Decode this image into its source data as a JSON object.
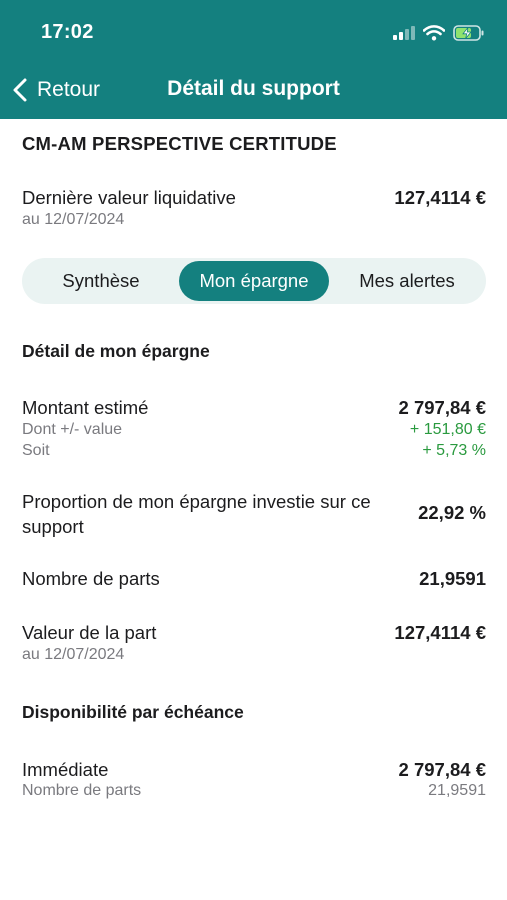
{
  "status_bar": {
    "time": "17:02"
  },
  "nav": {
    "back_label": "Retour",
    "title": "Détail du support"
  },
  "fund": {
    "name": "CM-AM PERSPECTIVE CERTITUDE",
    "nav_label": "Dernière valeur liquidative",
    "nav_date": "au 12/07/2024",
    "nav_value": "127,4114 €"
  },
  "tabs": [
    {
      "label": "Synthèse",
      "active": false
    },
    {
      "label": "Mon épargne",
      "active": true
    },
    {
      "label": "Mes alertes",
      "active": false
    }
  ],
  "savings_detail": {
    "section_title": "Détail de mon épargne",
    "estimated_label": "Montant estimé",
    "estimated_value": "2 797,84 €",
    "gain_label": "Dont +/- value",
    "gain_value": "+ 151,80 €",
    "ratio_label": "Soit",
    "ratio_value": "+ 5,73 %",
    "proportion_label": "Proportion de mon épargne investie sur ce support",
    "proportion_value": "22,92 %",
    "units_label": "Nombre de parts",
    "units_value": "21,9591",
    "unit_price_label": "Valeur de la part",
    "unit_price_date": "au 12/07/2024",
    "unit_price_value": "127,4114 €"
  },
  "availability": {
    "section_title": "Disponibilité par échéance",
    "label": "Immédiate",
    "value": "2 797,84 €",
    "units_label": "Nombre de parts",
    "units_value": "21,9591"
  },
  "colors": {
    "header_bg": "#14807f",
    "positive": "#2a9a3f",
    "segment_bg": "#eaf3f2"
  }
}
